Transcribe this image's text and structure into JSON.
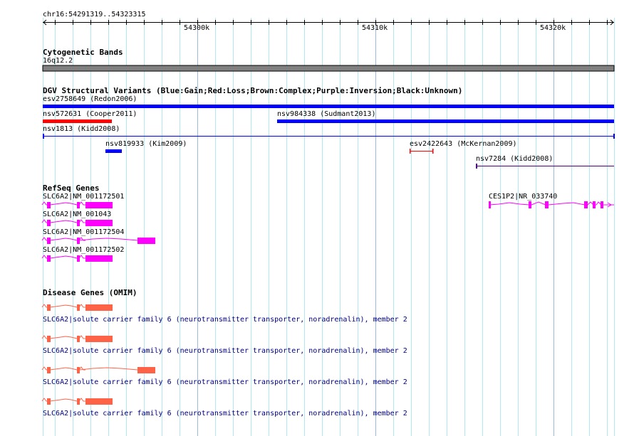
{
  "ruler": {
    "location": "chr16:54291319..54323315",
    "ticks": [
      "54300k",
      "54310k",
      "54320k"
    ]
  },
  "tracks": {
    "cytoband": {
      "title": "Cytogenetic Bands",
      "band": "16q12.2",
      "color": "#808080"
    },
    "dgv": {
      "title": "DGV Structural Variants (Blue:Gain;Red:Loss;Brown:Complex;Purple:Inversion;Black:Unknown)",
      "features": [
        {
          "label": "esv2758649 (Redon2006)",
          "color": "#0000ff"
        },
        {
          "label": "nsv572631 (Cooper2011)",
          "color": "#ff0000"
        },
        {
          "label": "nsv984338 (Sudmant2013)",
          "color": "#0000ff"
        },
        {
          "label": "nsv1813 (Kidd2008)",
          "color": "#0000ff"
        },
        {
          "label": "nsv819933 (Kim2009)",
          "color": "#0000ff"
        },
        {
          "label": "esv2422643 (McKernan2009)",
          "color": "#ff0000"
        },
        {
          "label": "nsv7284 (Kidd2008)",
          "color": "#4b0082"
        }
      ]
    },
    "refseq": {
      "title": "RefSeq Genes",
      "color": "#ff00ff",
      "transcripts": [
        {
          "label": "SLC6A2|NM_001172501"
        },
        {
          "label": "SLC6A2|NM_001043"
        },
        {
          "label": "SLC6A2|NM_001172504"
        },
        {
          "label": "SLC6A2|NM_001172502"
        },
        {
          "label": "CES1P2|NR_033740"
        }
      ]
    },
    "omim": {
      "title": "Disease Genes (OMIM)",
      "color": "#ff6347",
      "entries": [
        {
          "label": "SLC6A2|solute carrier family 6 (neurotransmitter transporter, noradrenalin), member 2"
        },
        {
          "label": "SLC6A2|solute carrier family 6 (neurotransmitter transporter, noradrenalin), member 2"
        },
        {
          "label": "SLC6A2|solute carrier family 6 (neurotransmitter transporter, noradrenalin), member 2"
        },
        {
          "label": "SLC6A2|solute carrier family 6 (neurotransmitter transporter, noradrenalin), member 2"
        }
      ]
    }
  }
}
